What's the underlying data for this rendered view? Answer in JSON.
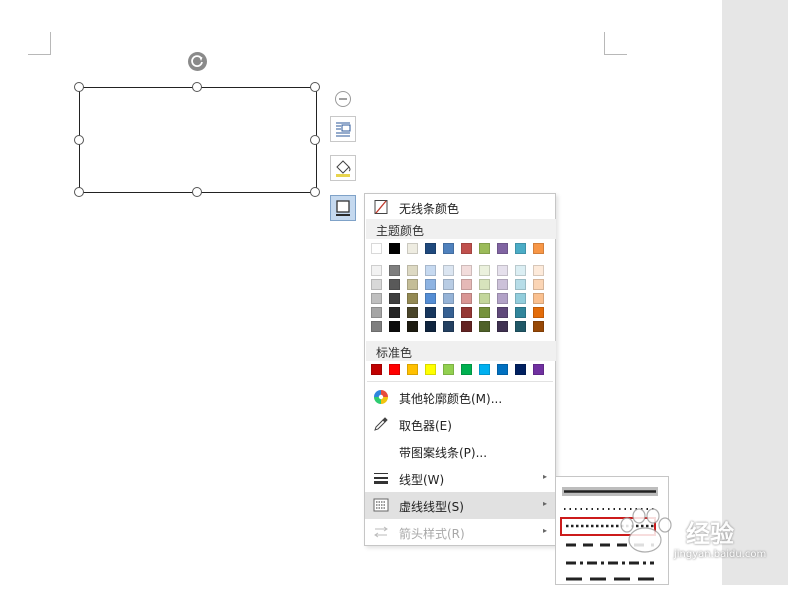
{
  "menu": {
    "no_outline": "无线条颜色",
    "theme_colors_label": "主题颜色",
    "standard_colors_label": "标准色",
    "more_colors": "其他轮廓颜色(M)...",
    "eyedropper": "取色器(E)",
    "pattern_lines": "带图案线条(P)...",
    "weight": "线型(W)",
    "dashes": "虚线线型(S)",
    "arrows": "箭头样式(R)"
  },
  "theme_colors": {
    "top_row": [
      "#ffffff",
      "#000000",
      "#eeece1",
      "#1f497d",
      "#4f81bd",
      "#c0504d",
      "#9bbb59",
      "#8064a2",
      "#4bacc6",
      "#f79646"
    ],
    "shades": [
      [
        "#f2f2f2",
        "#7f7f7f",
        "#ddd9c3",
        "#c6d9f0",
        "#dbe5f1",
        "#f2dcdb",
        "#ebf1dd",
        "#e5e0ec",
        "#dbeef3",
        "#fdeada"
      ],
      [
        "#d8d8d8",
        "#595959",
        "#c4bd97",
        "#8db3e2",
        "#b8cce4",
        "#e5b9b7",
        "#d7e3bc",
        "#ccc1d9",
        "#b7dde8",
        "#fbd5b5"
      ],
      [
        "#bfbfbf",
        "#3f3f3f",
        "#938953",
        "#548dd4",
        "#95b3d7",
        "#d99694",
        "#c3d69b",
        "#b2a2c7",
        "#92cddc",
        "#fac08f"
      ],
      [
        "#a5a5a5",
        "#262626",
        "#494429",
        "#17365d",
        "#366092",
        "#953734",
        "#76923c",
        "#5f497a",
        "#31859b",
        "#e36c09"
      ],
      [
        "#7f7f7f",
        "#0c0c0c",
        "#1d1b10",
        "#0f243e",
        "#244061",
        "#632423",
        "#4f6128",
        "#3f3151",
        "#205867",
        "#974806"
      ]
    ]
  },
  "standard_colors": [
    "#c00000",
    "#ff0000",
    "#ffc000",
    "#ffff00",
    "#92d050",
    "#00b050",
    "#00b0f0",
    "#0070c0",
    "#002060",
    "#7030a0"
  ],
  "icons": {
    "no_outline": "diagonal-slash-icon",
    "more_colors": "color-wheel-icon",
    "eyedropper": "eyedropper-icon",
    "weight": "line-weight-icon",
    "dashes": "dash-type-icon",
    "arrows": "arrow-style-icon"
  },
  "dash_options": [
    "solid",
    "round-dot",
    "square-dot",
    "dash",
    "dash-dot",
    "long-dash"
  ],
  "selected_dash": "square-dot",
  "watermark": {
    "text": "经验",
    "url": "jingyan.baidu.com"
  }
}
